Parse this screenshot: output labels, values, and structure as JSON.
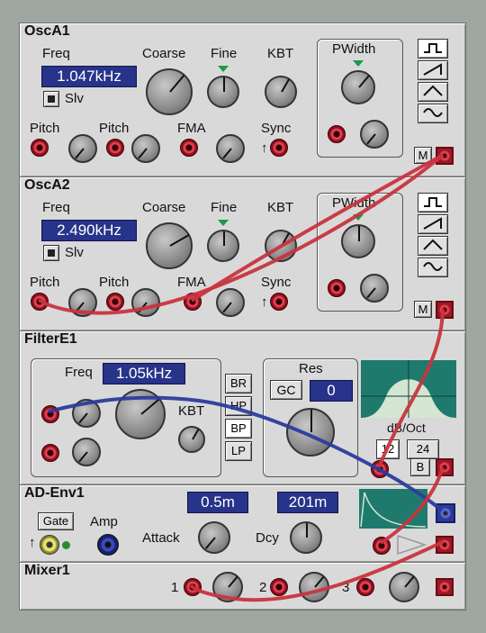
{
  "modules": {
    "osc1": {
      "title": "OscA1",
      "freq_label": "Freq",
      "freq_value": "1.047kHz",
      "coarse": "Coarse",
      "fine": "Fine",
      "kbt": "KBT",
      "pwidth": "PWidth",
      "slv": "Slv",
      "pitch1": "Pitch",
      "pitch2": "Pitch",
      "fma": "FMA",
      "sync": "Sync",
      "sync_arrow": "↑",
      "mute": "M"
    },
    "osc2": {
      "title": "OscA2",
      "freq_label": "Freq",
      "freq_value": "2.490kHz",
      "coarse": "Coarse",
      "fine": "Fine",
      "kbt": "KBT",
      "pwidth": "PWidth",
      "slv": "Slv",
      "pitch1": "Pitch",
      "pitch2": "Pitch",
      "fma": "FMA",
      "sync": "Sync",
      "sync_arrow": "↑",
      "mute": "M"
    },
    "filter": {
      "title": "FilterE1",
      "freq_label": "Freq",
      "freq_value": "1.05kHz",
      "kbt": "KBT",
      "res": "Res",
      "gc": "GC",
      "res_value": "0",
      "modes": [
        "BR",
        "HP",
        "BP",
        "LP"
      ],
      "db_oct": "dB/Oct",
      "slope1": "12",
      "slope2": "24",
      "bypass": "B"
    },
    "env": {
      "title": "AD-Env1",
      "gate": "Gate",
      "amp": "Amp",
      "attack_label": "Attack",
      "attack_value": "0.5m",
      "decay_label": "Dcy",
      "decay_value": "201m",
      "arrow": "↑"
    },
    "mixer": {
      "title": "Mixer1",
      "inputs": [
        "1",
        "2",
        "3"
      ]
    }
  },
  "colors": {
    "panel": "#d9d9d9",
    "display": "#28338a",
    "cable_red": "#c8343e",
    "cable_blue": "#2c3c9c",
    "scope": "#1f7a6e"
  }
}
